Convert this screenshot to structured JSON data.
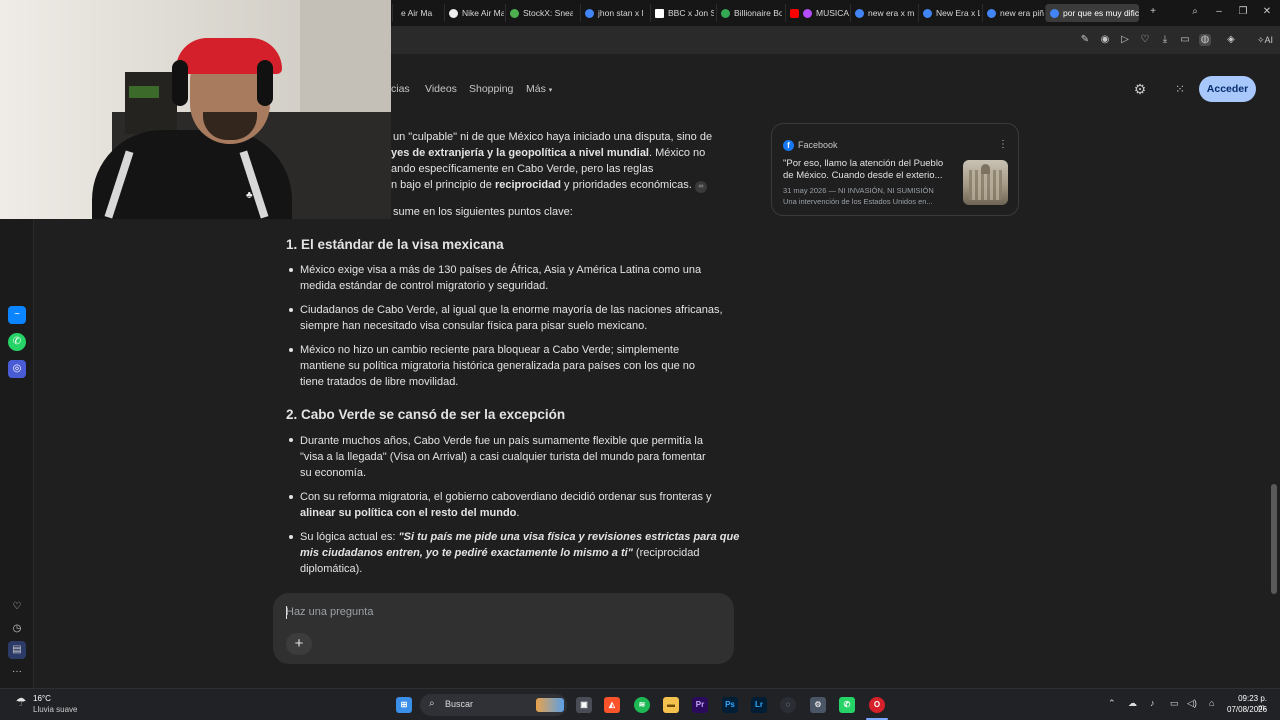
{
  "tabs": [
    {
      "label": "e Air Ma",
      "color": "#ffffff"
    },
    {
      "label": "Nike Air Max",
      "color": "#f5f5f5"
    },
    {
      "label": "StockX: Snea",
      "color": "#4caf50"
    },
    {
      "label": "jhon stan x l",
      "color": "#4285f4"
    },
    {
      "label": "BBC x Jon St",
      "color": "#ffffff"
    },
    {
      "label": "Billionaire Bo",
      "color": "#34a853"
    },
    {
      "label": "MUSICA",
      "color": "#ff0000"
    },
    {
      "label": "new era x m",
      "color": "#4285f4"
    },
    {
      "label": "New Era x Li",
      "color": "#4285f4"
    },
    {
      "label": "new era piñ",
      "color": "#4285f4"
    },
    {
      "label": "por que es muy dific",
      "color": "#4285f4"
    }
  ],
  "nav": {
    "item1": "cias",
    "videos": "Videos",
    "shopping": "Shopping",
    "more": "Más"
  },
  "acceder_label": "Acceder",
  "content": {
    "intro": {
      "l1": "un \"culpable\" ni de que México haya iniciado una disputa, sino de",
      "l2_bold": "yes de extranjería y la geopolítica a nivel mundial",
      "l2_rest": ". México no",
      "l3": "ando específicamente en Cabo Verde, pero las reglas",
      "l4_a": "n bajo el principio de ",
      "l4_bold": "reciprocidad",
      "l4_b": " y prioridades económicas.",
      "l5": "sume en los siguientes puntos clave:"
    },
    "section1": {
      "heading": "1. El estándar de la visa mexicana",
      "b1": [
        "México exige visa a más de 130 países de África, Asia y América Latina como una",
        "medida estándar de control migratorio y seguridad."
      ],
      "b2": [
        "Ciudadanos de Cabo Verde, al igual que la enorme mayoría de las naciones africanas,",
        "siempre han necesitado visa consular física para pisar suelo mexicano."
      ],
      "b3": [
        "México no hizo un cambio reciente para bloquear a Cabo Verde; simplemente",
        "mantiene su política migratoria histórica generalizada para países con los que no",
        "tiene tratados de libre movilidad."
      ]
    },
    "section2": {
      "heading": "2. Cabo Verde se cansó de ser la excepción",
      "b1": [
        "Durante muchos años, Cabo Verde fue un país sumamente flexible que permitía la",
        "\"visa a la llegada\" (Visa on Arrival) a casi cualquier turista del mundo para fomentar",
        "su economía."
      ],
      "b2_l1": "Con su reforma migratoria, el gobierno caboverdiano decidió ordenar sus fronteras y",
      "b2_bold": "alinear su política con el resto del mundo",
      "b2_end": ".",
      "b3_prefix": "Su lógica actual es: ",
      "b3_italic_l1": "\"Si tu país me pide una visa física y revisiones estrictas para que",
      "b3_italic_l2": "mis ciudadanos entren, yo te pediré exactamente lo mismo a ti\"",
      "b3_rest": " (reciprocidad",
      "b3_l3": "diplomática)."
    }
  },
  "source_card": {
    "source": "Facebook",
    "title_l1": "\"Por eso, llamo la atención del Pueblo",
    "title_l2": "de México. Cuando desde el exterio...",
    "meta": "31 may 2026 — NI INVASIÓN, NI SUMISIÓN",
    "snippet": "Una intervención de los Estados Unidos en..."
  },
  "prompt_placeholder": "Haz una pregunta",
  "taskbar": {
    "weather_temp": "16°C",
    "weather_desc": "Lluvia suave",
    "search_label": "Buscar",
    "time": "09:23 p. m.",
    "date": "07/08/2026"
  }
}
